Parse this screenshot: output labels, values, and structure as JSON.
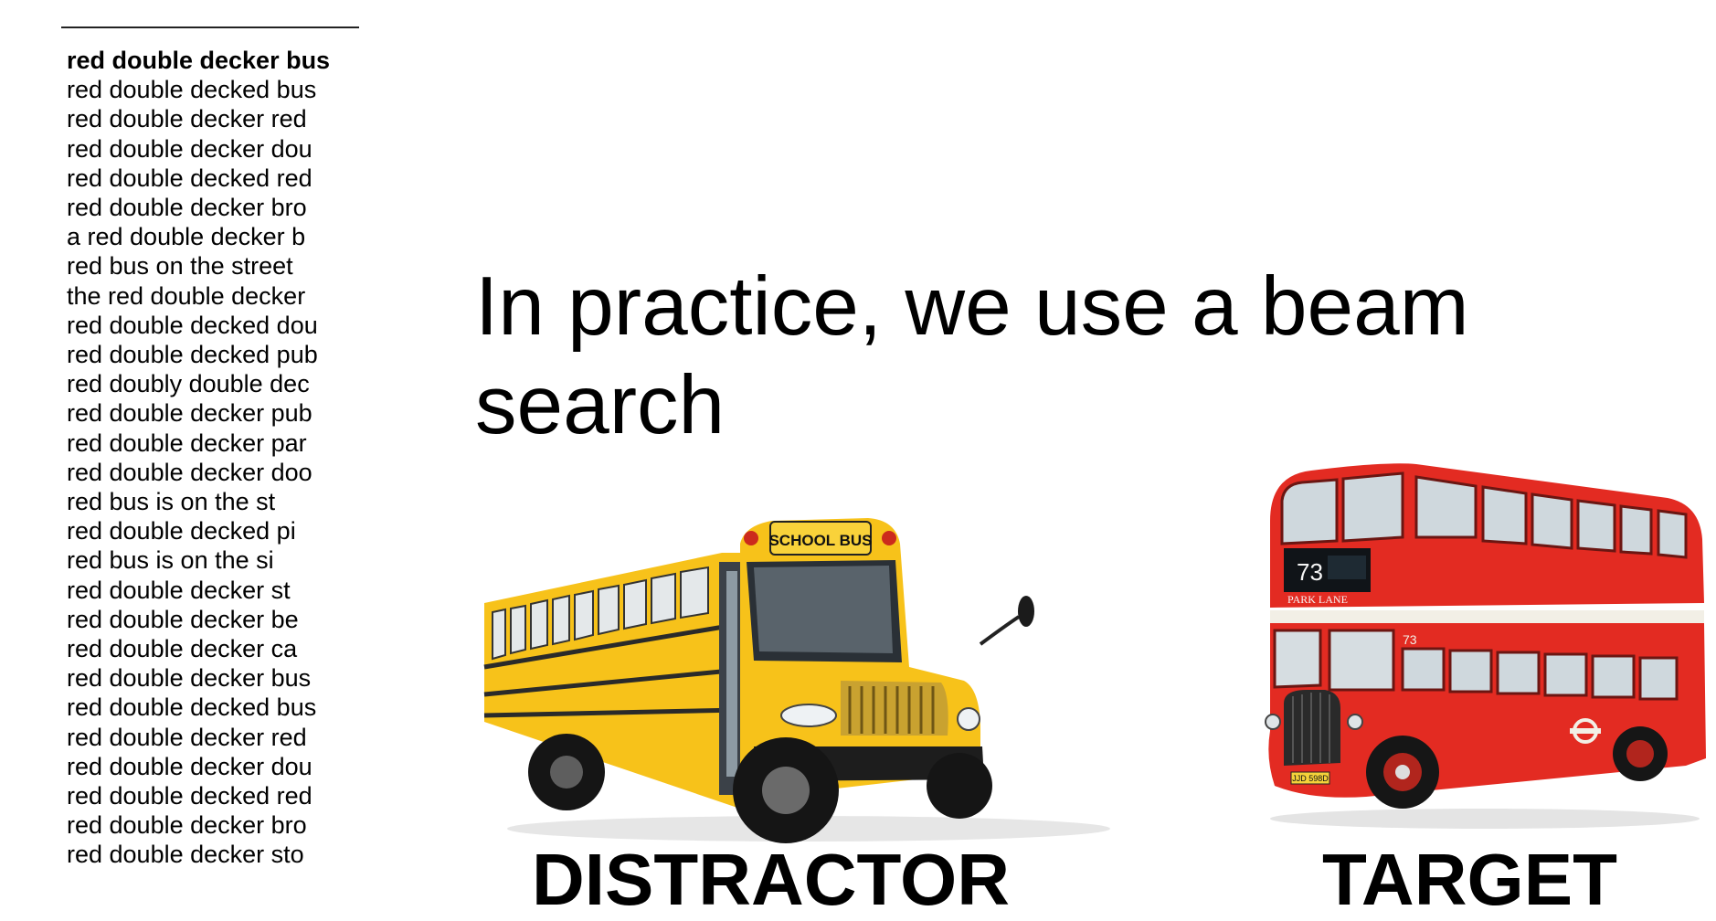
{
  "beam_candidates": [
    "red double decker bus",
    "red double decked bus",
    "red double decker red",
    "red double decker dou",
    "red double decked red",
    "red double decker bro",
    "a red double decker b",
    "red bus on the street",
    "the red double decker",
    "red double decked dou",
    "red double decked pub",
    "red doubly double dec",
    "red double decker pub",
    "red double decker par",
    "red double decker doo",
    "red bus is on the st",
    "red double decked pi",
    "red bus is on the si",
    "red double decker st",
    "red double decker be",
    "red double decker ca",
    "red double decker bus",
    "red double decked bus",
    "red double decker red",
    "red double decker dou",
    "red double decked red",
    "red double decker bro",
    "red double decker sto"
  ],
  "headline": "In practice, we use a beam search",
  "school_bus": {
    "label": "DISTRACTOR",
    "sign_text": "SCHOOL BUS",
    "body_color": "#f7c21a",
    "stripe_color": "#2a2a2a"
  },
  "london_bus": {
    "label": "TARGET",
    "route_number": "73",
    "destination": "PARK LANE",
    "side_number": "73",
    "plate": "JJD 598D",
    "body_color": "#e32b22",
    "band_color": "#f2efe6"
  }
}
